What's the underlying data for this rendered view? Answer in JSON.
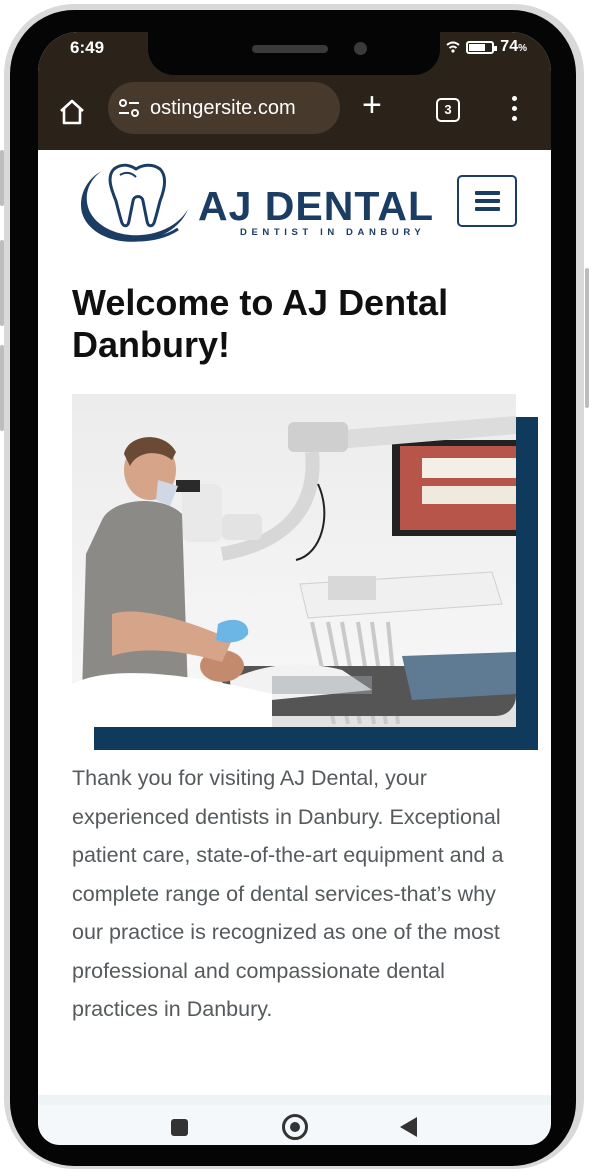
{
  "status_bar": {
    "time": "6:49",
    "battery": "74"
  },
  "browser": {
    "url": "ostingersite.com",
    "new_tab": "+",
    "tab_count": "3"
  },
  "logo": {
    "name": "AJ DENTAL",
    "tagline": "DENTIST IN DANBURY"
  },
  "page": {
    "title": "Welcome to AJ Dental Danbury!",
    "intro": "Thank you for visiting AJ Dental, your experienced dentists in Danbury. Exceptional patient care, state-of-the-art equipment and a complete range of dental services-that’s why our practice is recognized as one of the most professional and compassionate dental practices in Danbury."
  },
  "colors": {
    "brand": "#1c3d63",
    "browser_chrome": "#2b2319",
    "accent_block": "#0f3a5b"
  },
  "icons": {
    "home": "home-icon",
    "site_settings": "tune-icon",
    "menu": "more-vert-icon",
    "hamburger": "hamburger-icon",
    "recents": "square-icon",
    "home_nav": "circle-icon",
    "back": "back-triangle-icon"
  }
}
